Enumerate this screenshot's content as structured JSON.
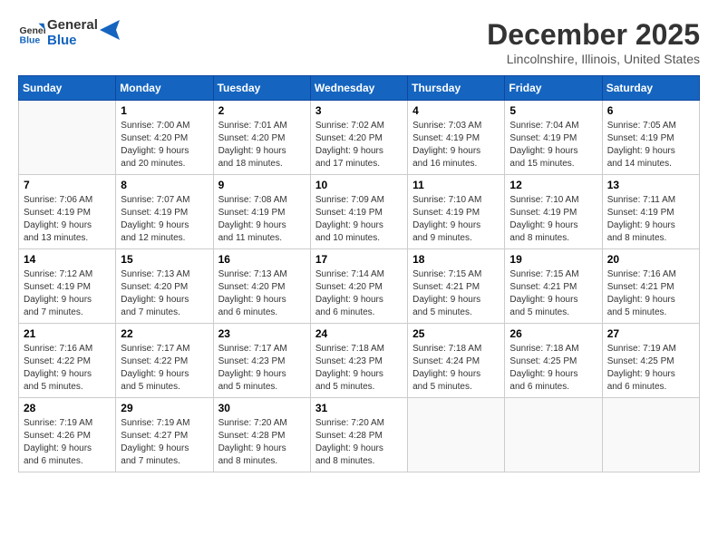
{
  "header": {
    "logo_line1": "General",
    "logo_line2": "Blue",
    "month": "December 2025",
    "location": "Lincolnshire, Illinois, United States"
  },
  "weekdays": [
    "Sunday",
    "Monday",
    "Tuesday",
    "Wednesday",
    "Thursday",
    "Friday",
    "Saturday"
  ],
  "weeks": [
    [
      {
        "day": "",
        "info": ""
      },
      {
        "day": "1",
        "info": "Sunrise: 7:00 AM\nSunset: 4:20 PM\nDaylight: 9 hours\nand 20 minutes."
      },
      {
        "day": "2",
        "info": "Sunrise: 7:01 AM\nSunset: 4:20 PM\nDaylight: 9 hours\nand 18 minutes."
      },
      {
        "day": "3",
        "info": "Sunrise: 7:02 AM\nSunset: 4:20 PM\nDaylight: 9 hours\nand 17 minutes."
      },
      {
        "day": "4",
        "info": "Sunrise: 7:03 AM\nSunset: 4:19 PM\nDaylight: 9 hours\nand 16 minutes."
      },
      {
        "day": "5",
        "info": "Sunrise: 7:04 AM\nSunset: 4:19 PM\nDaylight: 9 hours\nand 15 minutes."
      },
      {
        "day": "6",
        "info": "Sunrise: 7:05 AM\nSunset: 4:19 PM\nDaylight: 9 hours\nand 14 minutes."
      }
    ],
    [
      {
        "day": "7",
        "info": "Sunrise: 7:06 AM\nSunset: 4:19 PM\nDaylight: 9 hours\nand 13 minutes."
      },
      {
        "day": "8",
        "info": "Sunrise: 7:07 AM\nSunset: 4:19 PM\nDaylight: 9 hours\nand 12 minutes."
      },
      {
        "day": "9",
        "info": "Sunrise: 7:08 AM\nSunset: 4:19 PM\nDaylight: 9 hours\nand 11 minutes."
      },
      {
        "day": "10",
        "info": "Sunrise: 7:09 AM\nSunset: 4:19 PM\nDaylight: 9 hours\nand 10 minutes."
      },
      {
        "day": "11",
        "info": "Sunrise: 7:10 AM\nSunset: 4:19 PM\nDaylight: 9 hours\nand 9 minutes."
      },
      {
        "day": "12",
        "info": "Sunrise: 7:10 AM\nSunset: 4:19 PM\nDaylight: 9 hours\nand 8 minutes."
      },
      {
        "day": "13",
        "info": "Sunrise: 7:11 AM\nSunset: 4:19 PM\nDaylight: 9 hours\nand 8 minutes."
      }
    ],
    [
      {
        "day": "14",
        "info": "Sunrise: 7:12 AM\nSunset: 4:19 PM\nDaylight: 9 hours\nand 7 minutes."
      },
      {
        "day": "15",
        "info": "Sunrise: 7:13 AM\nSunset: 4:20 PM\nDaylight: 9 hours\nand 7 minutes."
      },
      {
        "day": "16",
        "info": "Sunrise: 7:13 AM\nSunset: 4:20 PM\nDaylight: 9 hours\nand 6 minutes."
      },
      {
        "day": "17",
        "info": "Sunrise: 7:14 AM\nSunset: 4:20 PM\nDaylight: 9 hours\nand 6 minutes."
      },
      {
        "day": "18",
        "info": "Sunrise: 7:15 AM\nSunset: 4:21 PM\nDaylight: 9 hours\nand 5 minutes."
      },
      {
        "day": "19",
        "info": "Sunrise: 7:15 AM\nSunset: 4:21 PM\nDaylight: 9 hours\nand 5 minutes."
      },
      {
        "day": "20",
        "info": "Sunrise: 7:16 AM\nSunset: 4:21 PM\nDaylight: 9 hours\nand 5 minutes."
      }
    ],
    [
      {
        "day": "21",
        "info": "Sunrise: 7:16 AM\nSunset: 4:22 PM\nDaylight: 9 hours\nand 5 minutes."
      },
      {
        "day": "22",
        "info": "Sunrise: 7:17 AM\nSunset: 4:22 PM\nDaylight: 9 hours\nand 5 minutes."
      },
      {
        "day": "23",
        "info": "Sunrise: 7:17 AM\nSunset: 4:23 PM\nDaylight: 9 hours\nand 5 minutes."
      },
      {
        "day": "24",
        "info": "Sunrise: 7:18 AM\nSunset: 4:23 PM\nDaylight: 9 hours\nand 5 minutes."
      },
      {
        "day": "25",
        "info": "Sunrise: 7:18 AM\nSunset: 4:24 PM\nDaylight: 9 hours\nand 5 minutes."
      },
      {
        "day": "26",
        "info": "Sunrise: 7:18 AM\nSunset: 4:25 PM\nDaylight: 9 hours\nand 6 minutes."
      },
      {
        "day": "27",
        "info": "Sunrise: 7:19 AM\nSunset: 4:25 PM\nDaylight: 9 hours\nand 6 minutes."
      }
    ],
    [
      {
        "day": "28",
        "info": "Sunrise: 7:19 AM\nSunset: 4:26 PM\nDaylight: 9 hours\nand 6 minutes."
      },
      {
        "day": "29",
        "info": "Sunrise: 7:19 AM\nSunset: 4:27 PM\nDaylight: 9 hours\nand 7 minutes."
      },
      {
        "day": "30",
        "info": "Sunrise: 7:20 AM\nSunset: 4:28 PM\nDaylight: 9 hours\nand 8 minutes."
      },
      {
        "day": "31",
        "info": "Sunrise: 7:20 AM\nSunset: 4:28 PM\nDaylight: 9 hours\nand 8 minutes."
      },
      {
        "day": "",
        "info": ""
      },
      {
        "day": "",
        "info": ""
      },
      {
        "day": "",
        "info": ""
      }
    ]
  ]
}
